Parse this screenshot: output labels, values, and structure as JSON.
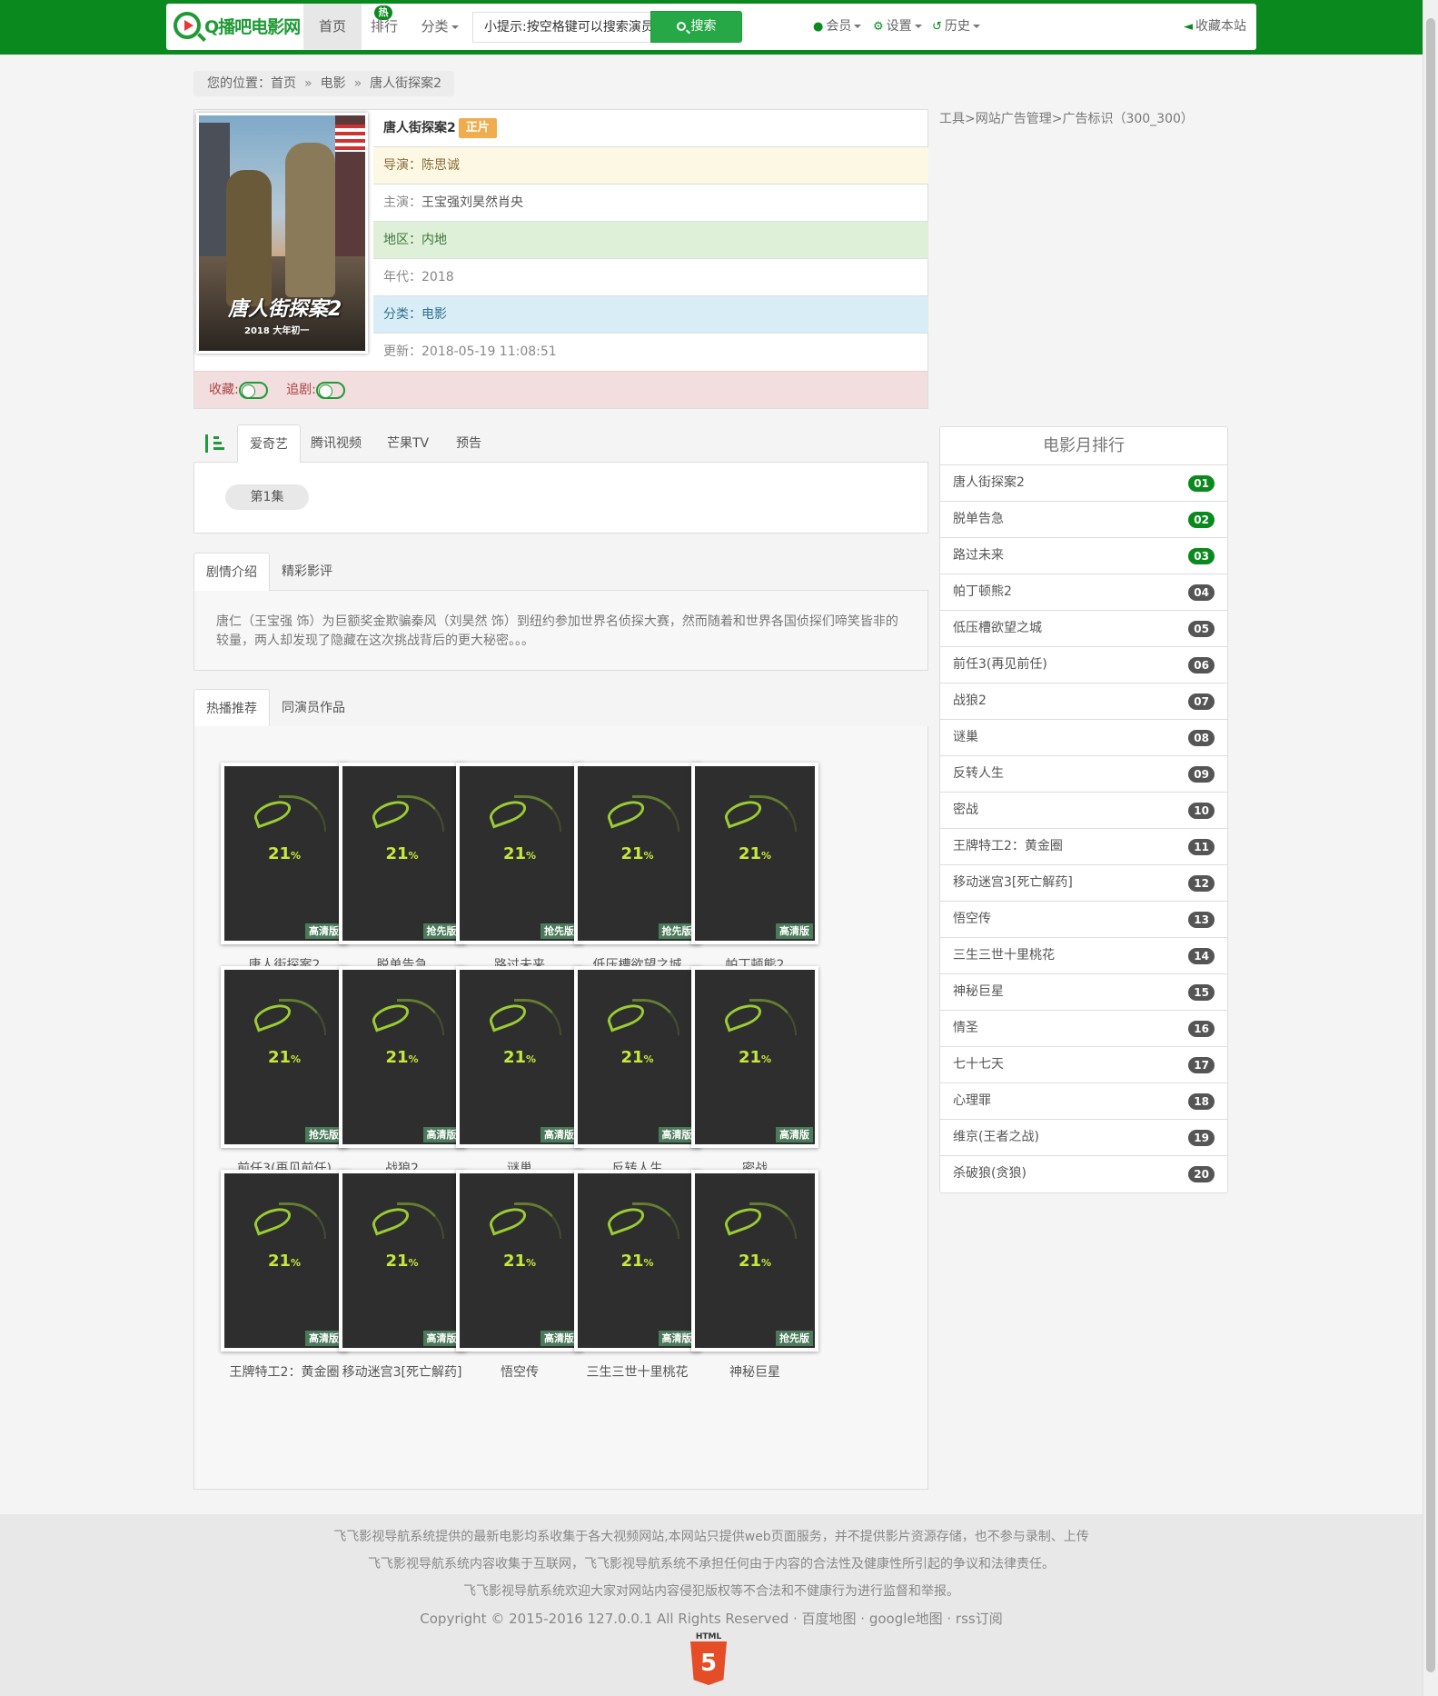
{
  "header": {
    "logo_text": "Q播吧电影网",
    "nav": {
      "home": "首页",
      "rank": "排行",
      "hot_badge": "热",
      "category": "分类"
    },
    "search": {
      "placeholder": "小提示:按空格键可以搜索演员",
      "button": "搜索"
    },
    "right": {
      "member": "会员",
      "settings": "设置",
      "history": "历史",
      "bookmark": "收藏本站"
    }
  },
  "breadcrumb": {
    "prefix": "您的位置：",
    "items": [
      "首页",
      "电影",
      "唐人街探案2"
    ],
    "sep": "»"
  },
  "movie": {
    "title": "唐人街探案2",
    "tag": "正片",
    "director_label": "导演：",
    "director": "陈思诚",
    "actors_label": "主演：",
    "actors": "王宝强刘昊然肖央",
    "area_label": "地区：",
    "area": "内地",
    "year_label": "年代：",
    "year": "2018",
    "category_label": "分类：",
    "category": "电影",
    "updated_label": "更新：",
    "updated": "2018-05-19 11:08:51",
    "poster_title": "唐人街探案2",
    "poster_sub": "2018 大年初一",
    "favorite_label": "收藏:",
    "follow_label": "追剧:"
  },
  "ad_text": "工具>网站广告管理>广告标识（300_300）",
  "sources": {
    "tabs": [
      "爱奇艺",
      "腾讯视频",
      "芒果TV",
      "预告"
    ],
    "episode": "第1集"
  },
  "plot_tabs": [
    "剧情介绍",
    "精彩影评"
  ],
  "plot": "唐仁（王宝强 饰）为巨额奖金欺骗秦风（刘昊然 饰）到纽约参加世界名侦探大赛，然而随着和世界各国侦探们啼笑皆非的较量，两人却发现了隐藏在这次挑战背后的更大秘密。。。",
  "rec_tabs": [
    "热播推荐",
    "同演员作品"
  ],
  "loading_pct": "21",
  "loading_unit": "%",
  "movies": [
    {
      "name": "唐人街探案2",
      "badge": "高清版"
    },
    {
      "name": "脱单告急",
      "badge": "抢先版"
    },
    {
      "name": "路过未来",
      "badge": "抢先版"
    },
    {
      "name": "低压槽欲望之城",
      "badge": "抢先版"
    },
    {
      "name": "帕丁顿熊2",
      "badge": "高清版"
    },
    {
      "name": "前任3(再见前任)",
      "badge": "抢先版"
    },
    {
      "name": "战狼2",
      "badge": "高清版"
    },
    {
      "name": "谜巢",
      "badge": "高清版"
    },
    {
      "name": "反转人生",
      "badge": "高清版"
    },
    {
      "name": "密战",
      "badge": "高清版"
    },
    {
      "name": "王牌特工2：黄金圈",
      "badge": "高清版"
    },
    {
      "name": "移动迷宫3[死亡解药]",
      "badge": "高清版"
    },
    {
      "name": "悟空传",
      "badge": "高清版"
    },
    {
      "name": "三生三世十里桃花",
      "badge": "高清版"
    },
    {
      "name": "神秘巨星",
      "badge": "抢先版"
    }
  ],
  "ranking": {
    "title": "电影月排行",
    "items": [
      {
        "name": "唐人街探案2",
        "num": "01"
      },
      {
        "name": "脱单告急",
        "num": "02"
      },
      {
        "name": "路过未来",
        "num": "03"
      },
      {
        "name": "帕丁顿熊2",
        "num": "04"
      },
      {
        "name": "低压槽欲望之城",
        "num": "05"
      },
      {
        "name": "前任3(再见前任)",
        "num": "06"
      },
      {
        "name": "战狼2",
        "num": "07"
      },
      {
        "name": "谜巢",
        "num": "08"
      },
      {
        "name": "反转人生",
        "num": "09"
      },
      {
        "name": "密战",
        "num": "10"
      },
      {
        "name": "王牌特工2：黄金圈",
        "num": "11"
      },
      {
        "name": "移动迷宫3[死亡解药]",
        "num": "12"
      },
      {
        "name": "悟空传",
        "num": "13"
      },
      {
        "name": "三生三世十里桃花",
        "num": "14"
      },
      {
        "name": "神秘巨星",
        "num": "15"
      },
      {
        "name": "情圣",
        "num": "16"
      },
      {
        "name": "七十七天",
        "num": "17"
      },
      {
        "name": "心理罪",
        "num": "18"
      },
      {
        "name": "维京(王者之战)",
        "num": "19"
      },
      {
        "name": "杀破狼(贪狼)",
        "num": "20"
      }
    ]
  },
  "footer": {
    "line1": "飞飞影视导航系统提供的最新电影均系收集于各大视频网站,本网站只提供web页面服务，并不提供影片资源存储，也不参与录制、上传",
    "line2": "飞飞影视导航系统内容收集于互联网，飞飞影视导航系统不承担任何由于内容的合法性及健康性所引起的争议和法律责任。",
    "line3": "飞飞影视导航系统欢迎大家对网站内容侵犯版权等不合法和不健康行为进行监督和举报。",
    "copyright": "Copyright © 2015-2016 127.0.0.1 All Rights Reserved · 百度地图 · google地图 · rss订阅",
    "html5_label": "HTML",
    "html5_num": "5"
  },
  "colors": {
    "brand": "#0a8a1e",
    "accent": "#27a846",
    "tag": "#f0ad4e"
  }
}
